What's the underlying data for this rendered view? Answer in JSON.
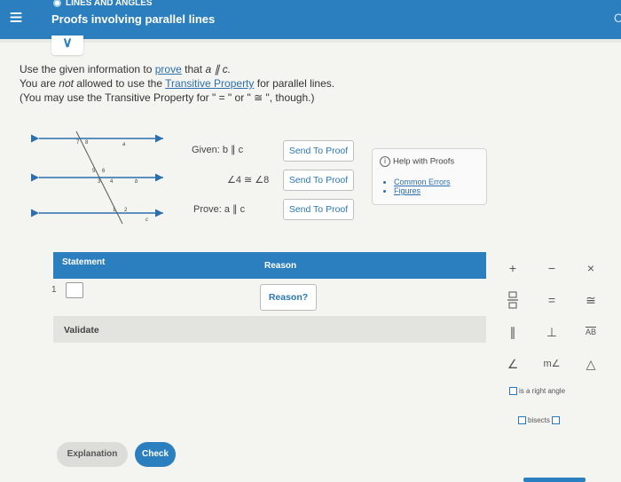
{
  "header": {
    "topic": "LINES AND ANGLES",
    "title": "Proofs involving parallel lines",
    "menu_icon": "hamburger-menu-icon",
    "edge_glyph": "C"
  },
  "collapse": {
    "icon": "chevron-down-icon",
    "glyph": "∨"
  },
  "instructions": {
    "l1_pre": "Use the given information to ",
    "l1_link": "prove",
    "l1_post": " that ",
    "l1_expr": "a ∥ c.",
    "l2_pre": "You are ",
    "l2_not": "not",
    "l2_mid": " allowed to use the ",
    "l2_link": "Transitive Property",
    "l2_post": " for parallel lines.",
    "l3": "(You may use the Transitive Property for \" = \" or \" ≅ \", though.)"
  },
  "figure": {
    "top_labels": [
      "7",
      "8",
      "a"
    ],
    "mid_labels": [
      "5",
      "6",
      "3",
      "4",
      "b"
    ],
    "bottom_labels": [
      "1",
      "2",
      "c"
    ]
  },
  "given": {
    "label": "Given: ",
    "expr": "b ∥ c"
  },
  "angles": {
    "expr": "∠4 ≅ ∠8"
  },
  "prove": {
    "label": "Prove: ",
    "expr": "a ∥ c"
  },
  "send_buttons": [
    "Send To Proof",
    "Send To Proof",
    "Send To Proof"
  ],
  "help": {
    "title": "Help with Proofs",
    "links": [
      "Common Errors",
      "Figures"
    ]
  },
  "table": {
    "statement_header": "Statement",
    "reason_header": "Reason",
    "row_number": "1",
    "reason_button": "Reason?"
  },
  "validate_label": "Validate",
  "explanation_label": "Explanation",
  "check_label": "Check",
  "palette": {
    "row1": [
      "+",
      "−",
      "×"
    ],
    "row2": [
      "fraction",
      "=",
      "≅"
    ],
    "row3": [
      "∥",
      "⊥",
      "AB"
    ],
    "row4": [
      "∠",
      "m∠",
      "△"
    ],
    "right_angle_label": "is a right angle",
    "bisects_label": "bisects"
  },
  "colors": {
    "accent": "#2c7fbf",
    "link": "#2c6fb0"
  }
}
